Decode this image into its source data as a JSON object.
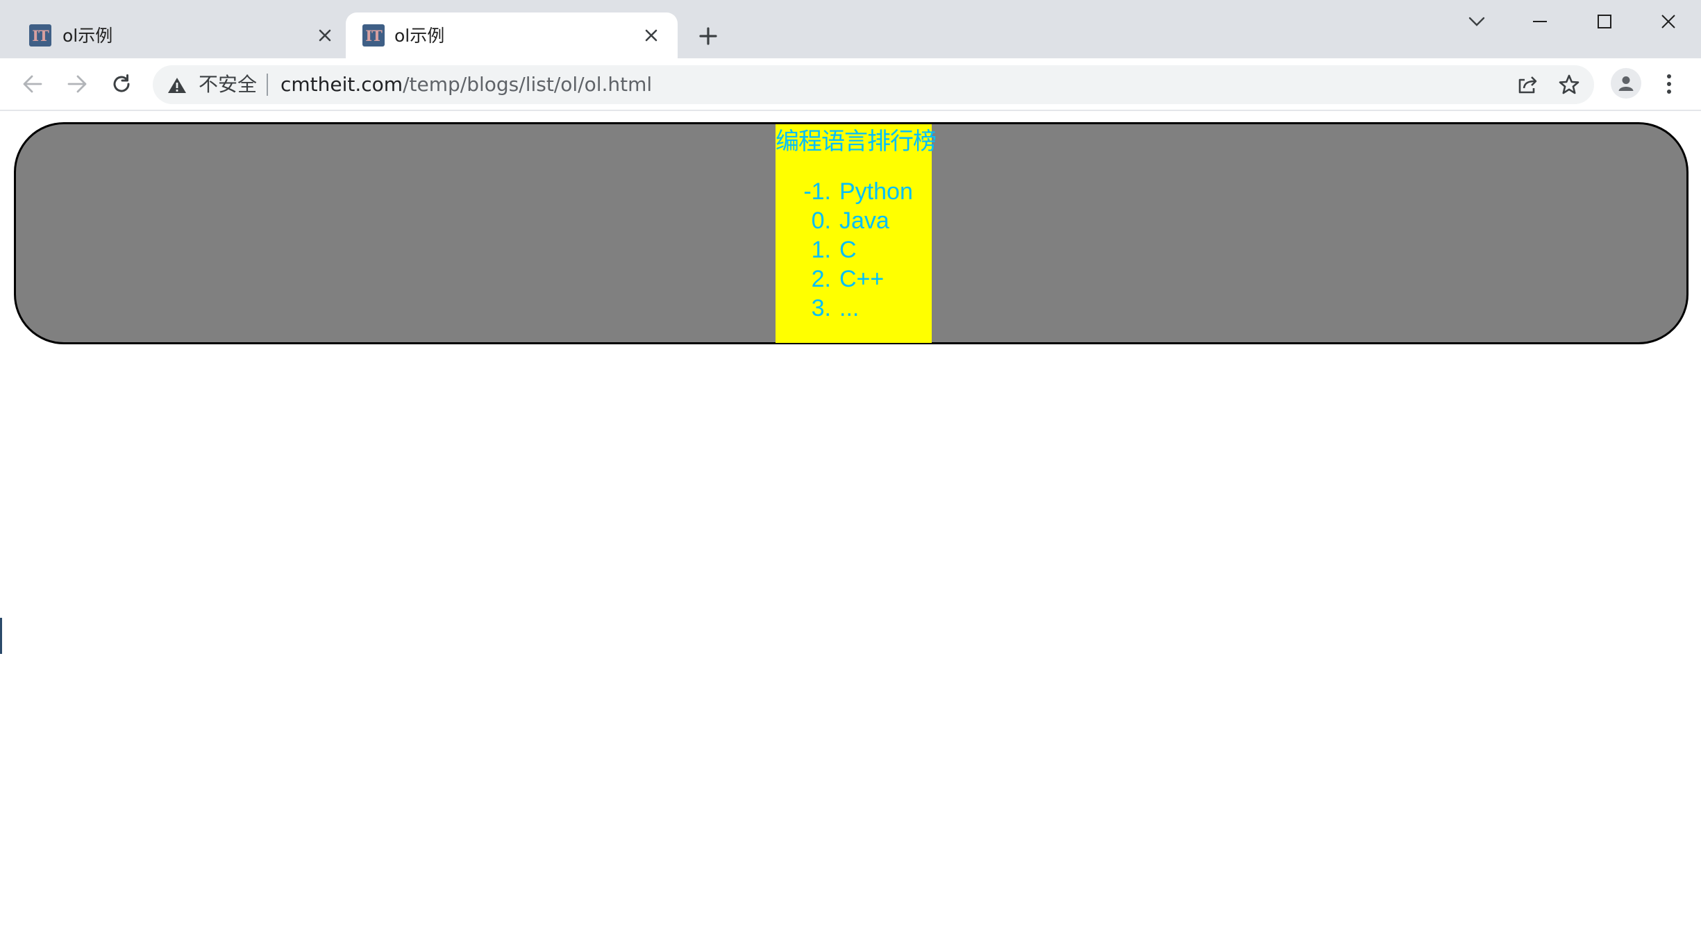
{
  "browser": {
    "tabs": [
      {
        "title": "ol示例",
        "favicon": "IT",
        "active": false
      },
      {
        "title": "ol示例",
        "favicon": "IT",
        "active": true
      }
    ],
    "address_bar": {
      "security_label": "不安全",
      "url_host": "cmtheit.com",
      "url_path": "/temp/blogs/list/ol/ol.html"
    },
    "icons": {
      "back": "arrow-left-icon",
      "forward": "arrow-right-icon",
      "reload": "reload-icon",
      "warning": "warning-triangle-icon",
      "share": "share-icon",
      "bookmark": "star-icon",
      "profile": "person-icon",
      "menu": "kebab-menu-icon",
      "new_tab": "plus-icon",
      "tab_search": "chevron-down-icon",
      "minimize": "minimize-icon",
      "maximize": "maximize-icon",
      "close": "close-icon"
    }
  },
  "page": {
    "heading": "编程语言排行榜",
    "list": [
      {
        "number": "-1.",
        "label": "Python"
      },
      {
        "number": "0.",
        "label": "Java"
      },
      {
        "number": "1.",
        "label": "C"
      },
      {
        "number": "2.",
        "label": "C++"
      },
      {
        "number": "3.",
        "label": "..."
      }
    ],
    "colors": {
      "outer_background": "#808080",
      "outer_border": "#000000",
      "inner_background": "#ffff00",
      "text": "#00bfff"
    }
  }
}
